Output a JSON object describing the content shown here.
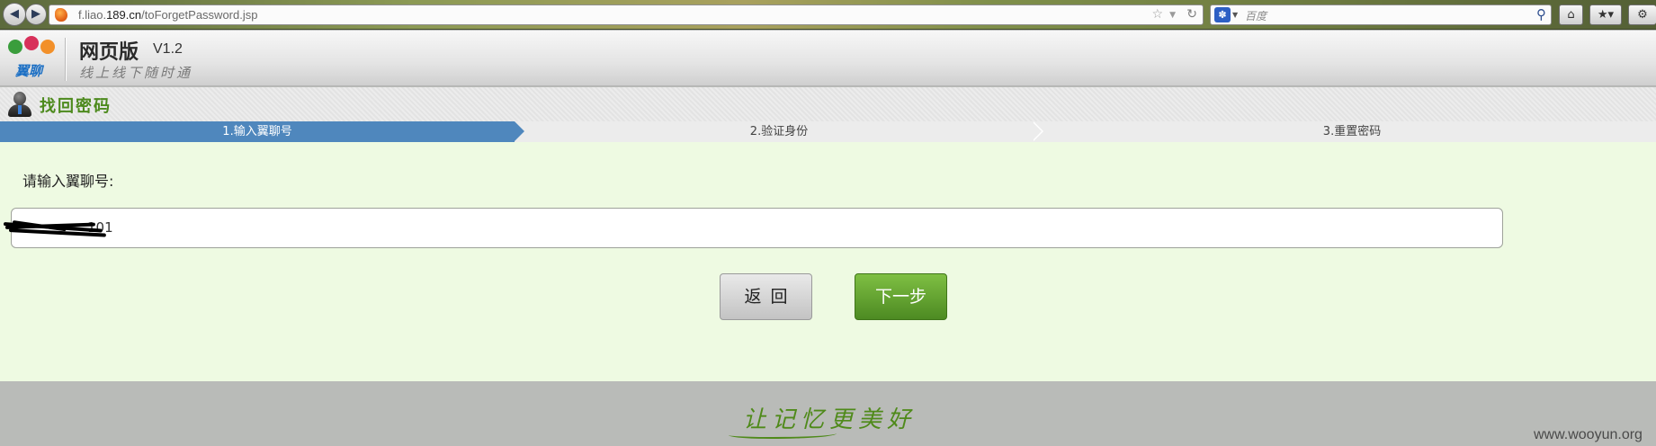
{
  "browser": {
    "url_prefix": "f.liao.",
    "url_domain": "189.cn",
    "url_path": "/toForgetPassword.jsp",
    "search_placeholder": "百度"
  },
  "header": {
    "logo_text": "翼聊",
    "title": "网页版",
    "version": "V1.2",
    "slogan": "线上线下随时通"
  },
  "section": {
    "title": "找回密码"
  },
  "steps": [
    {
      "label": "1.输入翼聊号",
      "active": true
    },
    {
      "label": "2.验证身份",
      "active": false
    },
    {
      "label": "3.重置密码",
      "active": false
    }
  ],
  "form": {
    "label": "请输入翼聊号:",
    "value_suffix": "101",
    "back_label": "返回",
    "next_label": "下一步"
  },
  "footer": {
    "slogan": "让记忆更美好",
    "watermark": "www.wooyun.org"
  },
  "colors": {
    "active_step": "#4f87bd",
    "form_bg": "#eefae2",
    "next_button": "#5a9a2a",
    "brand_green": "#4d8a1d"
  }
}
